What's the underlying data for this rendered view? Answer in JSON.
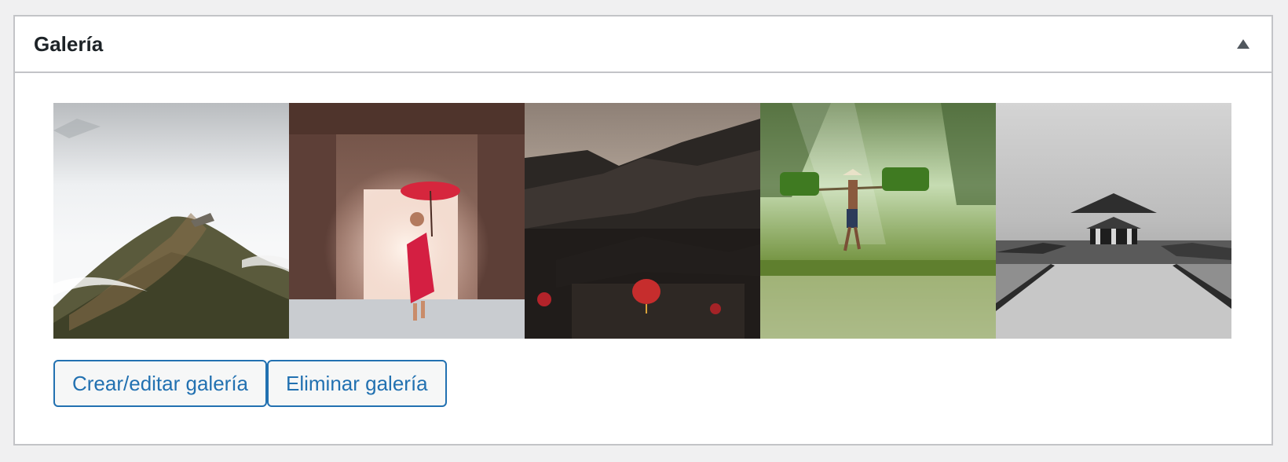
{
  "metabox": {
    "title": "Galería",
    "toggle_icon": "triangle-up-icon"
  },
  "gallery": {
    "images": [
      {
        "name": "great-wall-image"
      },
      {
        "name": "monk-umbrella-image"
      },
      {
        "name": "chinese-rooftops-lanterns-image"
      },
      {
        "name": "rice-farmer-image"
      },
      {
        "name": "pavilion-bw-image"
      }
    ]
  },
  "actions": {
    "edit_label": "Crear/editar galería",
    "delete_label": "Eliminar galería"
  },
  "colors": {
    "accent": "#2271b1",
    "border": "#c3c4c7",
    "background": "#f0f0f1"
  }
}
